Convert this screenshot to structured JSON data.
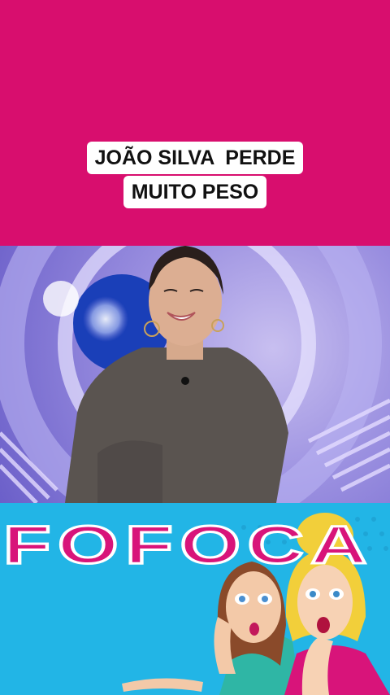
{
  "caption": {
    "line1": "JOÃO SILVA  PERDE",
    "line2": "MUITO PESO"
  },
  "banner": {
    "title": "FOFOCA"
  },
  "colors": {
    "background": "#d80e6e",
    "caption_bg": "#ffffff",
    "banner_bg": "#22b5e6",
    "banner_text": "#d8147a"
  }
}
